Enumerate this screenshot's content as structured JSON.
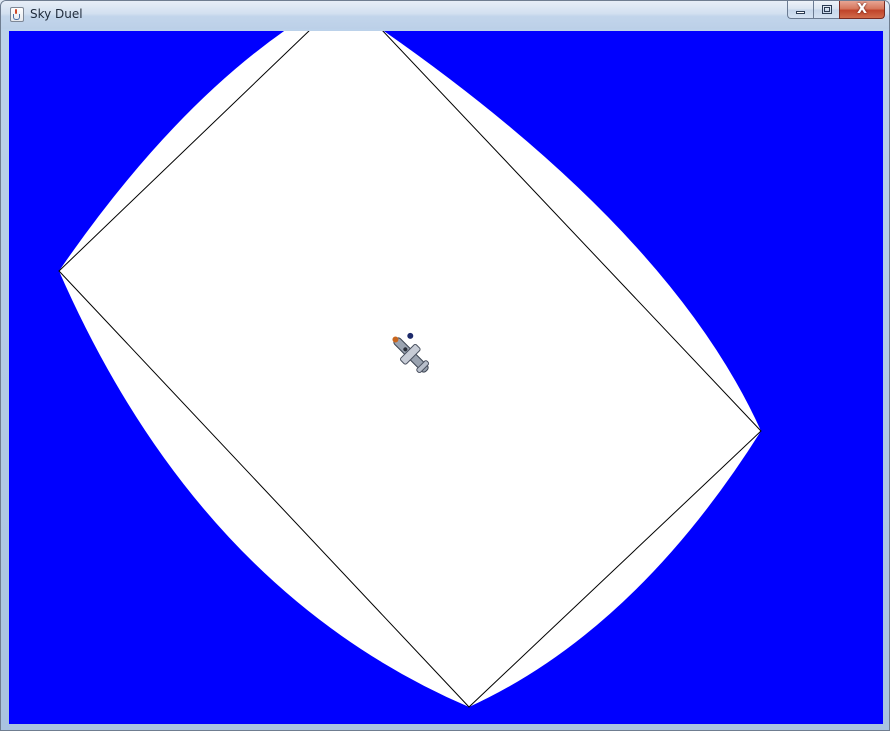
{
  "window": {
    "title": "Sky Duel",
    "icon": "java-cup-icon",
    "controls": {
      "minimize": "minimize-icon",
      "maximize": "maximize-icon",
      "close": "close-icon",
      "close_glyph": "X"
    }
  },
  "game": {
    "sky_color": "#0000ff",
    "arena_color": "#ffffff",
    "boundary_line_color": "#000000",
    "player": {
      "sprite": "biplane-icon",
      "heading_degrees": 135
    }
  }
}
